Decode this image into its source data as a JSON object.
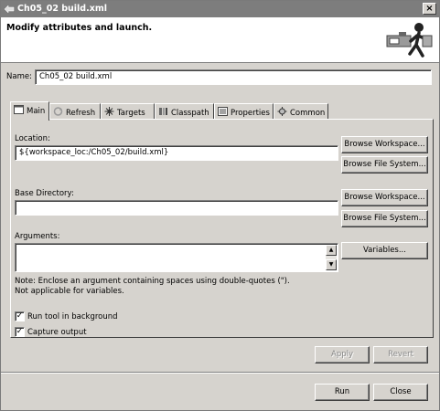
{
  "window": {
    "title": "Ch05_02 build.xml",
    "close": "×"
  },
  "banner": {
    "message": "Modify attributes and launch."
  },
  "name": {
    "label": "Name:",
    "value": "Ch05_02 build.xml"
  },
  "tabs": [
    {
      "label": "Main",
      "icon": "main-icon"
    },
    {
      "label": "Refresh",
      "icon": "refresh-icon"
    },
    {
      "label": "Targets",
      "icon": "targets-icon"
    },
    {
      "label": "Classpath",
      "icon": "classpath-icon"
    },
    {
      "label": "Properties",
      "icon": "properties-icon"
    },
    {
      "label": "Common",
      "icon": "common-icon"
    }
  ],
  "location": {
    "label": "Location:",
    "value": "${workspace_loc:/Ch05_02/build.xml}"
  },
  "base_directory": {
    "label": "Base Directory:",
    "value": ""
  },
  "browse": {
    "workspace": "Browse Workspace...",
    "file_system": "Browse File System..."
  },
  "arguments": {
    "label": "Arguments:",
    "value": "",
    "variables_button": "Variables..."
  },
  "note": {
    "line1": "Note: Enclose an argument containing spaces using double-quotes (\").",
    "line2": "Not applicable for variables."
  },
  "checkboxes": {
    "run_background": {
      "label": "Run tool in background",
      "checked": true,
      "mark": "✓"
    },
    "capture_output": {
      "label": "Capture output",
      "checked": true,
      "mark": "✓"
    }
  },
  "actions": {
    "apply": "Apply",
    "revert": "Revert",
    "run": "Run",
    "close": "Close"
  }
}
